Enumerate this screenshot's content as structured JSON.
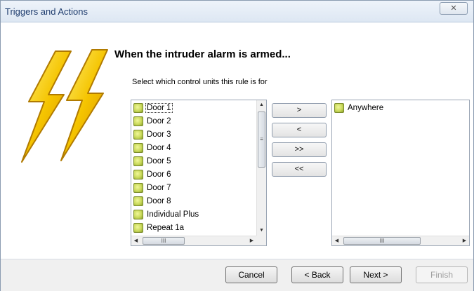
{
  "window": {
    "title": "Triggers and Actions",
    "close_glyph": "✕",
    "illustration": "lightning-bolts"
  },
  "heading": "When the intruder alarm is armed...",
  "instruction": "Select which control units this rule is for",
  "available_list": {
    "items": [
      {
        "label": "Door 1",
        "icon": "control-unit-icon"
      },
      {
        "label": "Door 2",
        "icon": "control-unit-icon"
      },
      {
        "label": "Door 3",
        "icon": "control-unit-icon"
      },
      {
        "label": "Door 4",
        "icon": "control-unit-icon"
      },
      {
        "label": "Door 5",
        "icon": "control-unit-icon"
      },
      {
        "label": "Door 6",
        "icon": "control-unit-icon"
      },
      {
        "label": "Door 7",
        "icon": "control-unit-icon"
      },
      {
        "label": "Door 8",
        "icon": "control-unit-icon"
      },
      {
        "label": "Individual Plus",
        "icon": "control-unit-icon"
      },
      {
        "label": "Repeat 1a",
        "icon": "control-unit-icon"
      }
    ],
    "selected_index": 0
  },
  "selected_list": {
    "items": [
      {
        "label": "Anywhere",
        "icon": "control-unit-icon"
      }
    ]
  },
  "move_buttons": {
    "add": ">",
    "remove": "<",
    "add_all": ">>",
    "remove_all": "<<"
  },
  "scrollbar_glyphs": {
    "up": "▲",
    "down": "▼",
    "left": "◀",
    "right": "▶",
    "grip_vertical": "≡",
    "grip_horizontal": "III"
  },
  "footer": {
    "cancel": "Cancel",
    "back": "< Back",
    "next": "Next >",
    "finish": "Finish",
    "finish_enabled": false
  },
  "colors": {
    "title_text": "#1e3c6e",
    "bolt_fill": "#f5c400",
    "icon_green": "#c9d95b"
  }
}
